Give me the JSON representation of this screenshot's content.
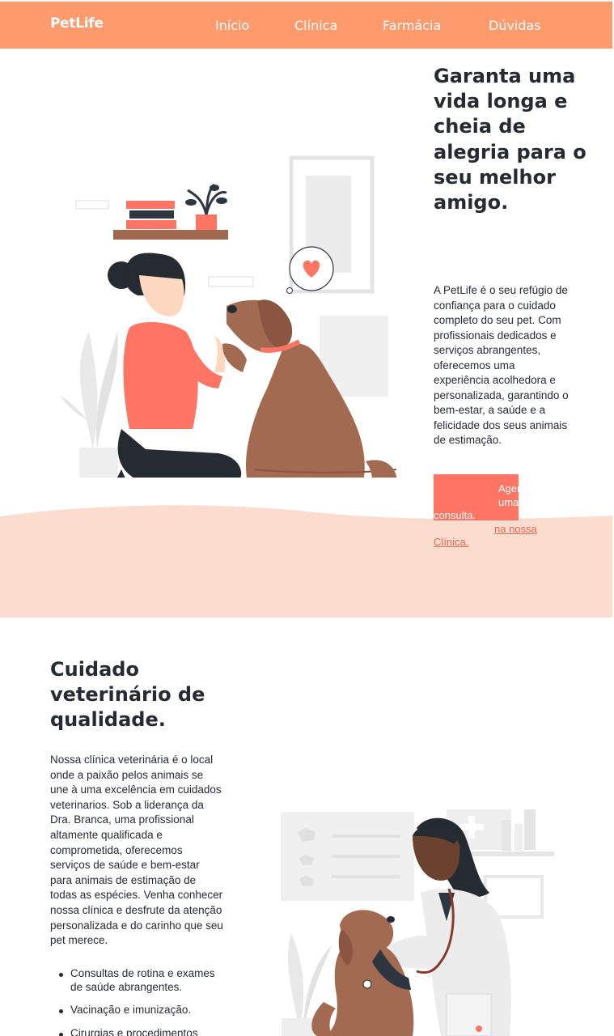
{
  "nav": {
    "logo": "PetLife",
    "links": [
      "Início",
      "Clínica",
      "Farmácia",
      "Dúvidas"
    ]
  },
  "hero": {
    "title": "Garanta uma vida longa e cheia de alegria para o seu melhor amigo.",
    "text": "A PetLife é o seu refúgio de confiança para o cuidado completo do seu pet. Com profissionais dedicados e serviços abrangentes, oferecemos uma experiência acolhedora e personalizada, garantindo o bem-estar, a saúde e a felicidade dos seus animais de estimação.",
    "cta_hidden": "Agende uma",
    "cta_line1": "consulta.",
    "cta_line2": "na nossa",
    "cta_line3": "Clínica."
  },
  "clinic": {
    "title": "Cuidado veterinário de qualidade.",
    "text": "Nossa clínica veterinária é o local onde a paixão pelos animais se une à uma excelência em cuidados veterinarios. Sob a liderança da Dra. Branca, uma profissional altamente qualificada e comprometida, oferecemos serviços de saúde e bem-estar para animais de estimação de todas as espécies. Venha conhecer nossa clínica e desfrute da atenção personalizada e do carinho que seu pet merece.",
    "services": [
      "Consultas de rotina e exames de saúde abrangentes.",
      "Vacinação e imunização.",
      "Cirurgias e procedimentos"
    ]
  },
  "colors": {
    "nav_bg": "#ff9a6c",
    "accent": "#ff7563",
    "wave": "#fddcd0",
    "text": "#262b31"
  }
}
